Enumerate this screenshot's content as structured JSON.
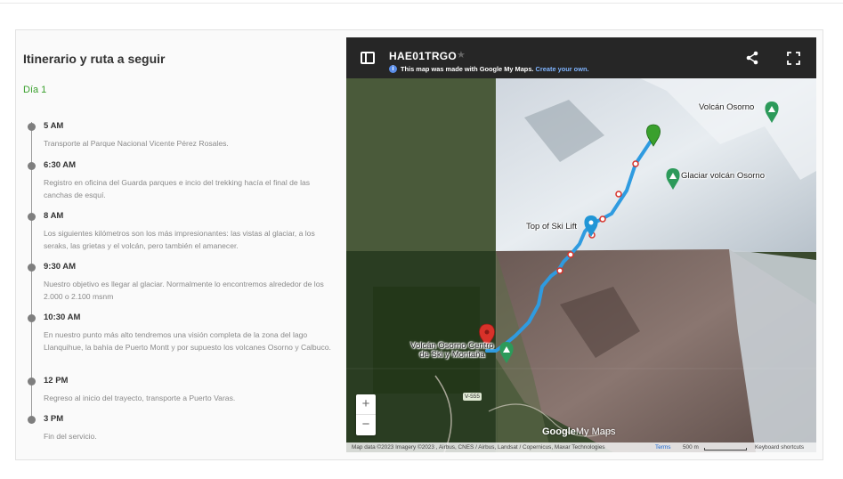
{
  "itinerary": {
    "title": "Itinerario y ruta a seguir",
    "day_label": "Día 1",
    "items": [
      {
        "time": "5 AM",
        "desc": "Transporte al Parque Nacional Vicente Pérez Rosales."
      },
      {
        "time": "6:30 AM",
        "desc": "Registro en oficina del Guarda parques e incio del trekking hacía el final de las canchas de esquí."
      },
      {
        "time": "8 AM",
        "desc": "Los siguientes kilómetros son los más impresionantes: las vistas al glaciar, a los seraks, las grietas y el volcán, pero también el amanecer."
      },
      {
        "time": "9:30 AM",
        "desc": "Nuestro objetivo es llegar al glaciar. Normalmente lo encontremos alrededor de los 2.000 o 2.100 msnm"
      },
      {
        "time": "10:30 AM",
        "desc": "En nuestro punto más alto tendremos una visión completa de la zona del lago Llanquihue, la bahía de Puerto Montt y por supuesto los volcanes Osorno y Calbuco."
      },
      {
        "time": "12 PM",
        "desc": "Regreso al inicio del trayecto, transporte a Puerto Varas."
      },
      {
        "time": "3 PM",
        "desc": "Fin del servicio."
      }
    ]
  },
  "map": {
    "title": "HAE01TRGO",
    "subtitle": "This map was made with Google My Maps.",
    "create_link": "Create your own.",
    "labels": {
      "volcan": "Volcán Osorno",
      "glaciar": "Glaciar volcán Osorno",
      "ski_lift": "Top of Ski Lift",
      "centro_line1": "Volcán Osorno Centro",
      "centro_line2": "de Ski y Montaña",
      "road": "V-555"
    },
    "zoom_in": "+",
    "zoom_out": "−",
    "logo_google": "Google",
    "logo_mymaps": "My Maps",
    "attribution": "Map data ©2023 Imagery ©2023 , Airbus, CNES / Airbus, Landsat / Copernicus, Maxar Technologies",
    "terms": "Terms",
    "scale": "500 m",
    "shortcuts": "Keyboard shortcuts",
    "colors": {
      "route": "#2f9be0",
      "pin_green": "#3aa02d",
      "pin_red": "#d8322a"
    }
  }
}
